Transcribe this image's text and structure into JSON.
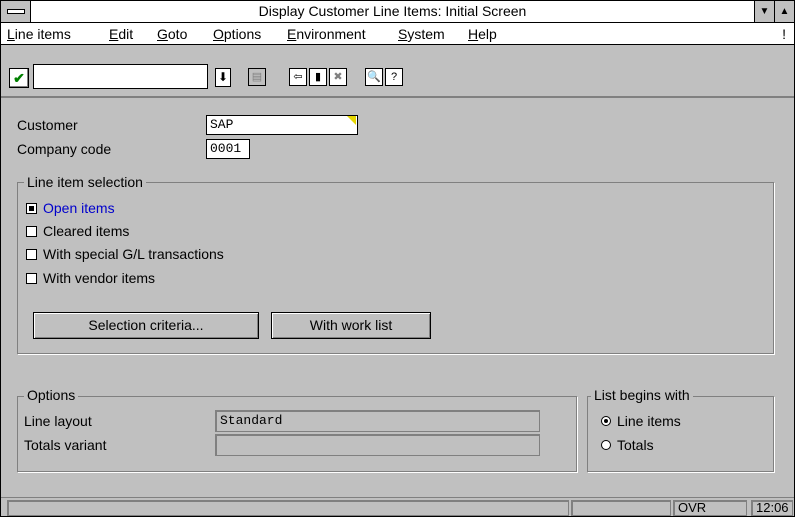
{
  "window": {
    "title": "Display Customer Line Items: Initial Screen",
    "min_glyph": "▼",
    "max_glyph": "▲"
  },
  "menu": [
    "Line items",
    "Edit",
    "Goto",
    "Options",
    "Environment",
    "System",
    "Help"
  ],
  "menu_extra": "!",
  "toolbar": {
    "command_value": ""
  },
  "form": {
    "customer_label": "Customer",
    "customer_value": "SAP",
    "company_label": "Company code",
    "company_value": "0001"
  },
  "line_item_selection": {
    "title": "Line item selection",
    "options": [
      {
        "label": "Open items",
        "checked": true
      },
      {
        "label": "Cleared items",
        "checked": false
      },
      {
        "label": "With special G/L transactions",
        "checked": false
      },
      {
        "label": "With vendor items",
        "checked": false
      }
    ],
    "selection_button": "Selection criteria...",
    "worklist_button": "With work list"
  },
  "options": {
    "title": "Options",
    "layout_label": "Line layout",
    "layout_value": "Standard",
    "totals_label": "Totals variant",
    "totals_value": ""
  },
  "list_begins": {
    "title": "List begins with",
    "line_items": "Line items",
    "totals": "Totals",
    "selected": "Line items"
  },
  "status": {
    "mode": "OVR",
    "time": "12:06"
  }
}
